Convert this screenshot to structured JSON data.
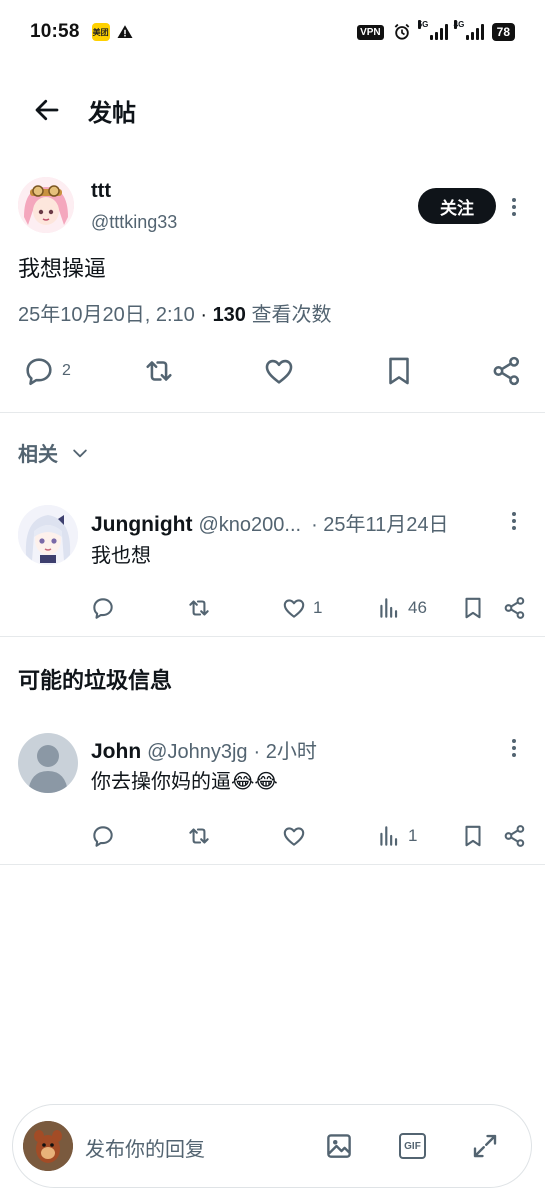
{
  "status_bar": {
    "time": "10:58",
    "meituan": "美团",
    "vpn": "VPN",
    "net1": "5G",
    "net2": "4G",
    "battery": "78"
  },
  "header": {
    "title": "发帖"
  },
  "post": {
    "display_name": "ttt",
    "handle": "@tttking33",
    "follow_label": "关注",
    "text": "我想操逼",
    "date": "25年10月20日, 2:10",
    "views_count": "130",
    "views_label": "查看次数",
    "reply_count": "2"
  },
  "related": {
    "label": "相关"
  },
  "reply1": {
    "display_name": "Jungnight",
    "handle": "@kno200...",
    "date": "· 25年11月24日",
    "text": "我也想",
    "like_count": "1",
    "views_count": "46"
  },
  "spam": {
    "heading": "可能的垃圾信息"
  },
  "reply2": {
    "display_name": "John",
    "handle": "@Johny3jg",
    "date": "· 2小时",
    "text": "你去操你妈的逼😂😂",
    "views_count": "1"
  },
  "composer": {
    "placeholder": "发布你的回复"
  },
  "colors": {
    "follow_bg": "#0f1419",
    "text_primary": "#0f1419",
    "text_secondary": "#536471",
    "divider": "#e6e9eb"
  }
}
